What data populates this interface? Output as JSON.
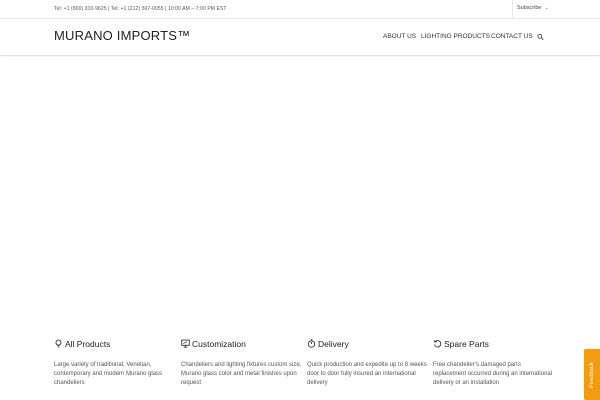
{
  "topbar": {
    "contact_text": "Tel: +1 (800) 310-9625 | Tel: +1 (212) 307-0055 | 10:00 AM – 7:00 PM EST",
    "subscribe_label": "Subscribe",
    "subscribe_icon": "chevron-down-icon"
  },
  "header": {
    "logo": "MURANO IMPORTS™",
    "nav": {
      "about": "ABOUT US",
      "lighting": "LIGHTING PRODUCTS",
      "contact": "CONTACT US"
    },
    "search_icon": "search-icon"
  },
  "features": [
    {
      "icon": "lightbulb-icon",
      "title": "All Products",
      "desc": "Large variety of traditional, Venetian, contemporary and modern Murano glass chandeliers"
    },
    {
      "icon": "monitor-icon",
      "title": "Customization",
      "desc": "Chandeliers and lighting fixtures custom size, Murano glass color and metal finishes upon request"
    },
    {
      "icon": "stopwatch-icon",
      "title": "Delivery",
      "desc": "Quick production and expedite up to 8 weeks door to door fully insured an international delivery"
    },
    {
      "icon": "rotate-icon",
      "title": "Spare Parts",
      "desc": "Free chandelier’s damaged parts replacement occurred during an international delivery or an installation"
    }
  ],
  "feedback_tab": {
    "label": "Feedback",
    "color": "#f39c12"
  }
}
